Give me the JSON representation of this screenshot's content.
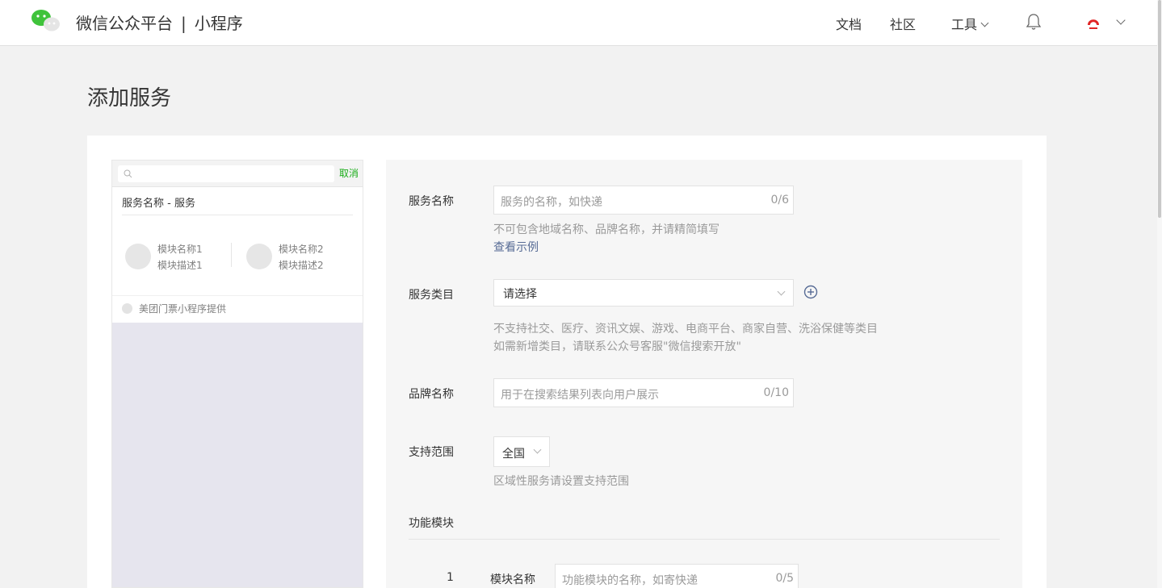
{
  "header": {
    "brand": "微信公众平台",
    "separator": "|",
    "product": "小程序",
    "nav": {
      "docs": "文档",
      "community": "社区",
      "tools": "工具"
    },
    "icons": {
      "logo": "wechat-logo",
      "notifications": "bell-icon",
      "avatar": "avatar-image",
      "account_menu": "chevron-down-icon"
    }
  },
  "page": {
    "title": "添加服务"
  },
  "preview": {
    "search_cancel": "取消",
    "service_title": "服务名称 - 服务",
    "modules": [
      {
        "name": "模块名称1",
        "desc": "模块描述1"
      },
      {
        "name": "模块名称2",
        "desc": "模块描述2"
      }
    ],
    "provider": "美团门票小程序提供"
  },
  "form": {
    "service_name": {
      "label": "服务名称",
      "placeholder": "服务的名称，如快递",
      "counter": "0/6",
      "hint": "不可包含地域名称、品牌名称，并请精简填写",
      "example_link": "查看示例"
    },
    "category": {
      "label": "服务类目",
      "value": "请选择",
      "hint_line1": "不支持社交、医疗、资讯文娱、游戏、电商平台、商家自营、洗浴保健等类目",
      "hint_line2": "如需新增类目，请联系公众号客服\"微信搜索开放\""
    },
    "brand_name": {
      "label": "品牌名称",
      "placeholder": "用于在搜索结果列表向用户展示",
      "counter": "0/10"
    },
    "scope": {
      "label": "支持范围",
      "value": "全国",
      "hint": "区域性服务请设置支持范围"
    },
    "modules_section": {
      "label": "功能模块",
      "rows": [
        {
          "index": "1",
          "label": "模块名称",
          "placeholder": "功能模块的名称，如寄快递",
          "counter": "0/5"
        }
      ]
    }
  },
  "colors": {
    "accent_green": "#1aad19",
    "link_blue": "#576b95",
    "background": "#f2f2f2"
  }
}
